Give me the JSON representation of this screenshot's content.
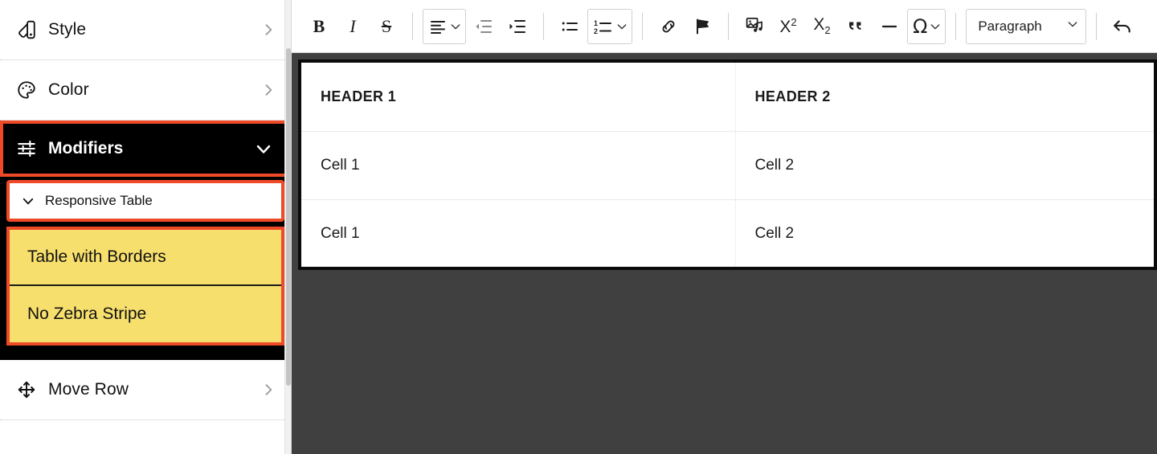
{
  "sidebar": {
    "items": [
      {
        "id": "style",
        "label": "Style",
        "icon": "style-swatch-icon",
        "chevron": "chevron-right"
      },
      {
        "id": "color",
        "label": "Color",
        "icon": "color-palette-icon",
        "chevron": "chevron-right"
      },
      {
        "id": "move-row",
        "label": "Move Row",
        "icon": "move-arrows-icon",
        "chevron": "chevron-right"
      }
    ],
    "modifiers": {
      "label": "Modifiers",
      "icon": "sliders-icon",
      "chevron": "chevron-down",
      "expanded": true,
      "highlight_color": "#ef4a27",
      "background": "#000000",
      "text_color": "#ffffff"
    },
    "responsive_table": {
      "label": "Responsive Table",
      "chevron": "chevron-down",
      "expanded": true,
      "highlight_color": "#ef4a27"
    },
    "options": [
      {
        "id": "table-with-borders",
        "label": "Table with Borders",
        "highlight_color": "#f7df6d"
      },
      {
        "id": "no-zebra-stripe",
        "label": "No Zebra Stripe",
        "highlight_color": "#f7df6d"
      }
    ]
  },
  "toolbar": {
    "buttons": [
      {
        "id": "bold",
        "label": "B",
        "name": "bold-button"
      },
      {
        "id": "italic",
        "label": "I",
        "name": "italic-button"
      },
      {
        "id": "strikethrough",
        "label": "S",
        "name": "strikethrough-button"
      },
      {
        "id": "align",
        "label": "",
        "name": "text-align-dropdown"
      },
      {
        "id": "outdent",
        "label": "",
        "name": "decrease-indent-button"
      },
      {
        "id": "indent",
        "label": "",
        "name": "increase-indent-button"
      },
      {
        "id": "bulleted-list",
        "label": "",
        "name": "bulleted-list-button"
      },
      {
        "id": "numbered-list",
        "label": "",
        "name": "numbered-list-dropdown"
      },
      {
        "id": "link",
        "label": "",
        "name": "link-button"
      },
      {
        "id": "anchor",
        "label": "",
        "name": "flag-anchor-button"
      },
      {
        "id": "media",
        "label": "",
        "name": "insert-media-button"
      },
      {
        "id": "superscript",
        "label": "X",
        "name": "superscript-button"
      },
      {
        "id": "subscript",
        "label": "X",
        "name": "subscript-button"
      },
      {
        "id": "blockquote",
        "label": "",
        "name": "blockquote-button"
      },
      {
        "id": "horizontal-rule",
        "label": "",
        "name": "horizontal-rule-button"
      },
      {
        "id": "special-char",
        "label": "Ω",
        "name": "special-character-dropdown"
      },
      {
        "id": "undo",
        "label": "",
        "name": "undo-button"
      }
    ],
    "superscript_base": "X",
    "superscript_exp": "2",
    "subscript_base": "X",
    "subscript_idx": "2",
    "omega": "Ω",
    "format_select": {
      "value": "Paragraph",
      "options": [
        "Paragraph"
      ]
    }
  },
  "editor": {
    "table": {
      "headers": [
        "HEADER 1",
        "HEADER 2"
      ],
      "rows": [
        [
          "Cell 1",
          "Cell 2"
        ],
        [
          "Cell 1",
          "Cell 2"
        ]
      ]
    },
    "canvas_background": "#404040",
    "table_border_color": "#0a0a0a"
  }
}
